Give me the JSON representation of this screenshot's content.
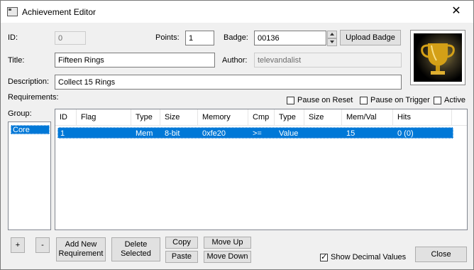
{
  "window": {
    "title": "Achievement Editor"
  },
  "labels": {
    "id": "ID:",
    "points": "Points:",
    "badge": "Badge:",
    "title": "Title:",
    "author": "Author:",
    "description": "Description:",
    "requirements": "Requirements:",
    "group": "Group:"
  },
  "fields": {
    "id": "0",
    "points": "1",
    "badge": "00136",
    "title": "Fifteen Rings",
    "author": "televandalist",
    "description": "Collect 15 Rings"
  },
  "buttons": {
    "upload_badge": "Upload Badge",
    "add_group": "+",
    "remove_group": "-",
    "add_requirement": "Add New Requirement",
    "delete_selected": "Delete Selected",
    "copy": "Copy",
    "paste": "Paste",
    "move_up": "Move Up",
    "move_down": "Move Down",
    "close": "Close"
  },
  "checkboxes": {
    "pause_on_reset": {
      "label": "Pause on Reset",
      "checked": false
    },
    "pause_on_trigger": {
      "label": "Pause on Trigger",
      "checked": false
    },
    "active": {
      "label": "Active",
      "checked": false
    },
    "show_decimal": {
      "label": "Show Decimal Values",
      "checked": true
    }
  },
  "groups": [
    "Core"
  ],
  "table": {
    "columns": [
      "ID",
      "Flag",
      "Type",
      "Size",
      "Memory",
      "Cmp",
      "Type",
      "Size",
      "Mem/Val",
      "Hits"
    ],
    "rows": [
      [
        "1",
        "",
        "Mem",
        "8-bit",
        "0xfe20",
        ">=",
        "Value",
        "",
        "15",
        "0 (0)"
      ]
    ]
  },
  "icons": {
    "window": "window-icon",
    "close": "close-icon",
    "badge": "trophy-icon"
  },
  "colors": {
    "selection": "#0078d7",
    "window_bg": "#f0f0f0"
  }
}
